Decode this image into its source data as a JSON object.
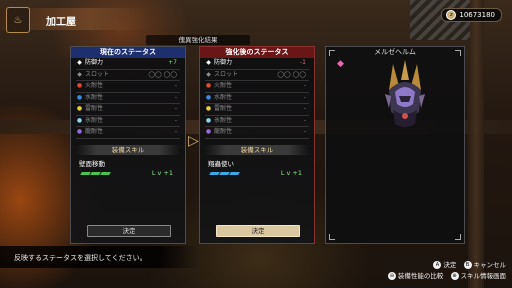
{
  "header": {
    "title": "加工屋",
    "badge_glyph": "♨"
  },
  "currency": {
    "coin_symbol": "z",
    "value": "10673180"
  },
  "banner": "傀異強化結果",
  "current": {
    "title": "現在のステータス",
    "defense_label": "防御力",
    "defense_value": "+7",
    "slot_label": "スロット",
    "slot_value": "◯◯ ◯◯",
    "fire_label": "火耐性",
    "fire_value": "-",
    "water_label": "水耐性",
    "water_value": "-",
    "thunder_label": "雷耐性",
    "thunder_value": "-",
    "ice_label": "氷耐性",
    "ice_value": "-",
    "dragon_label": "龍耐性",
    "dragon_value": "-",
    "skill_header": "装備スキル",
    "skill_name": "壁面移動",
    "skill_level": "L v +1",
    "decide": "決定"
  },
  "after": {
    "title": "強化後のステータス",
    "defense_label": "防御力",
    "defense_value": "-1",
    "slot_label": "スロット",
    "slot_value": "◯◯ ◯◯",
    "fire_label": "火耐性",
    "fire_value": "-",
    "water_label": "水耐性",
    "water_value": "-",
    "thunder_label": "雷耐性",
    "thunder_value": "-",
    "ice_label": "氷耐性",
    "ice_value": "-",
    "dragon_label": "龍耐性",
    "dragon_value": "-",
    "skill_header": "装備スキル",
    "skill_name": "翔蟲使い",
    "skill_level": "L v +1",
    "decide": "決定"
  },
  "preview": {
    "title": "メルゼヘルム"
  },
  "message": "反映するステータスを選択してください。",
  "controls": {
    "confirm_btn": "A",
    "confirm": "決定",
    "cancel_btn": "B",
    "cancel": "キャンセル",
    "compare_btn": "⊖",
    "compare": "装備性能の比較",
    "skillinfo_btn": "⊕",
    "skillinfo": "スキル情報画面"
  },
  "colors": {
    "current_header": "#1d2f6e",
    "after_header": "#6b1616",
    "positive": "#6ee66e",
    "negative": "#e36a6a"
  }
}
